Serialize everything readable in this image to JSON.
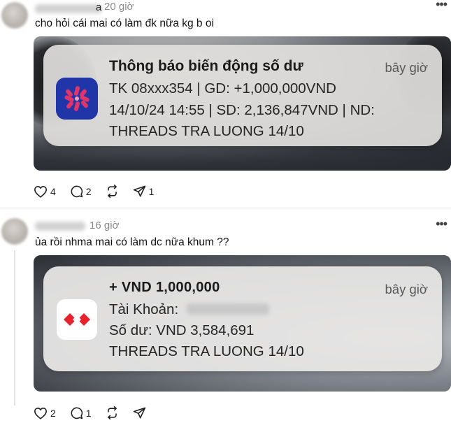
{
  "posts": [
    {
      "name_suffix": "a",
      "time": "20 giờ",
      "text": "cho hỏi cái mai có làm đk nữa kg b oi",
      "notification": {
        "title": "Thông báo biến động số dư",
        "time": "bây giờ",
        "line1": "TK 08xxx354 | GD: +1,000,000VND",
        "line2": "14/10/24 14:55 | SD: 2,136,847VND | ND:",
        "line3": "THREADS TRA LUONG 14/10"
      },
      "likes": "4",
      "replies": "2",
      "shares": "1"
    },
    {
      "time": "16 giờ",
      "text": "ủa rồi nhma mai có làm dc nữa khum ??",
      "notification": {
        "title": "+ VND 1,000,000",
        "time": "bây giờ",
        "line1": "Tài Khoản:",
        "line2": "Số dư: VND 3,584,691",
        "line3": "THREADS TRA LUONG 14/10"
      },
      "likes": "2",
      "replies": "1"
    }
  ],
  "icons": {
    "like": "heart-icon",
    "reply": "comment-icon",
    "repost": "repost-icon",
    "share": "send-icon",
    "more": "more-icon"
  },
  "colors": {
    "tcb_red": "#e8222c",
    "mb_blue": "#2035a8",
    "mb_accent": "#e0356b"
  }
}
